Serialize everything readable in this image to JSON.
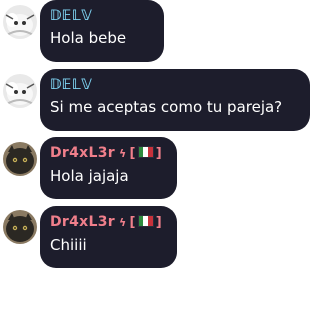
{
  "messages": [
    {
      "author": "𝔻𝔼𝕃𝕍",
      "author_color": "#7fd3f2",
      "text": "Hola bebe"
    },
    {
      "author": "𝔻𝔼𝕃𝕍",
      "author_color": "#7fd3f2",
      "text": "Si me aceptas como tu pareja?"
    },
    {
      "author": "Dr4xL3r",
      "author_color": "#f07f8b",
      "badge_bolt": "ϟ",
      "badge_open": "[",
      "badge_close": "]",
      "text": "Hola jajaja"
    },
    {
      "author": "Dr4xL3r",
      "author_color": "#f07f8b",
      "badge_bolt": "ϟ",
      "badge_open": "[",
      "badge_close": "]",
      "text": "Chiiii"
    }
  ],
  "colors": {
    "bubble": "#1d1d2c",
    "flag_green": "#2e8b3e",
    "flag_white": "#ffffff",
    "flag_red": "#c8313b"
  },
  "icons": {
    "avatar_1": "white-fluffy-creature-avatar",
    "avatar_2": "black-cat-avatar",
    "flag": "mexico-flag-icon"
  }
}
